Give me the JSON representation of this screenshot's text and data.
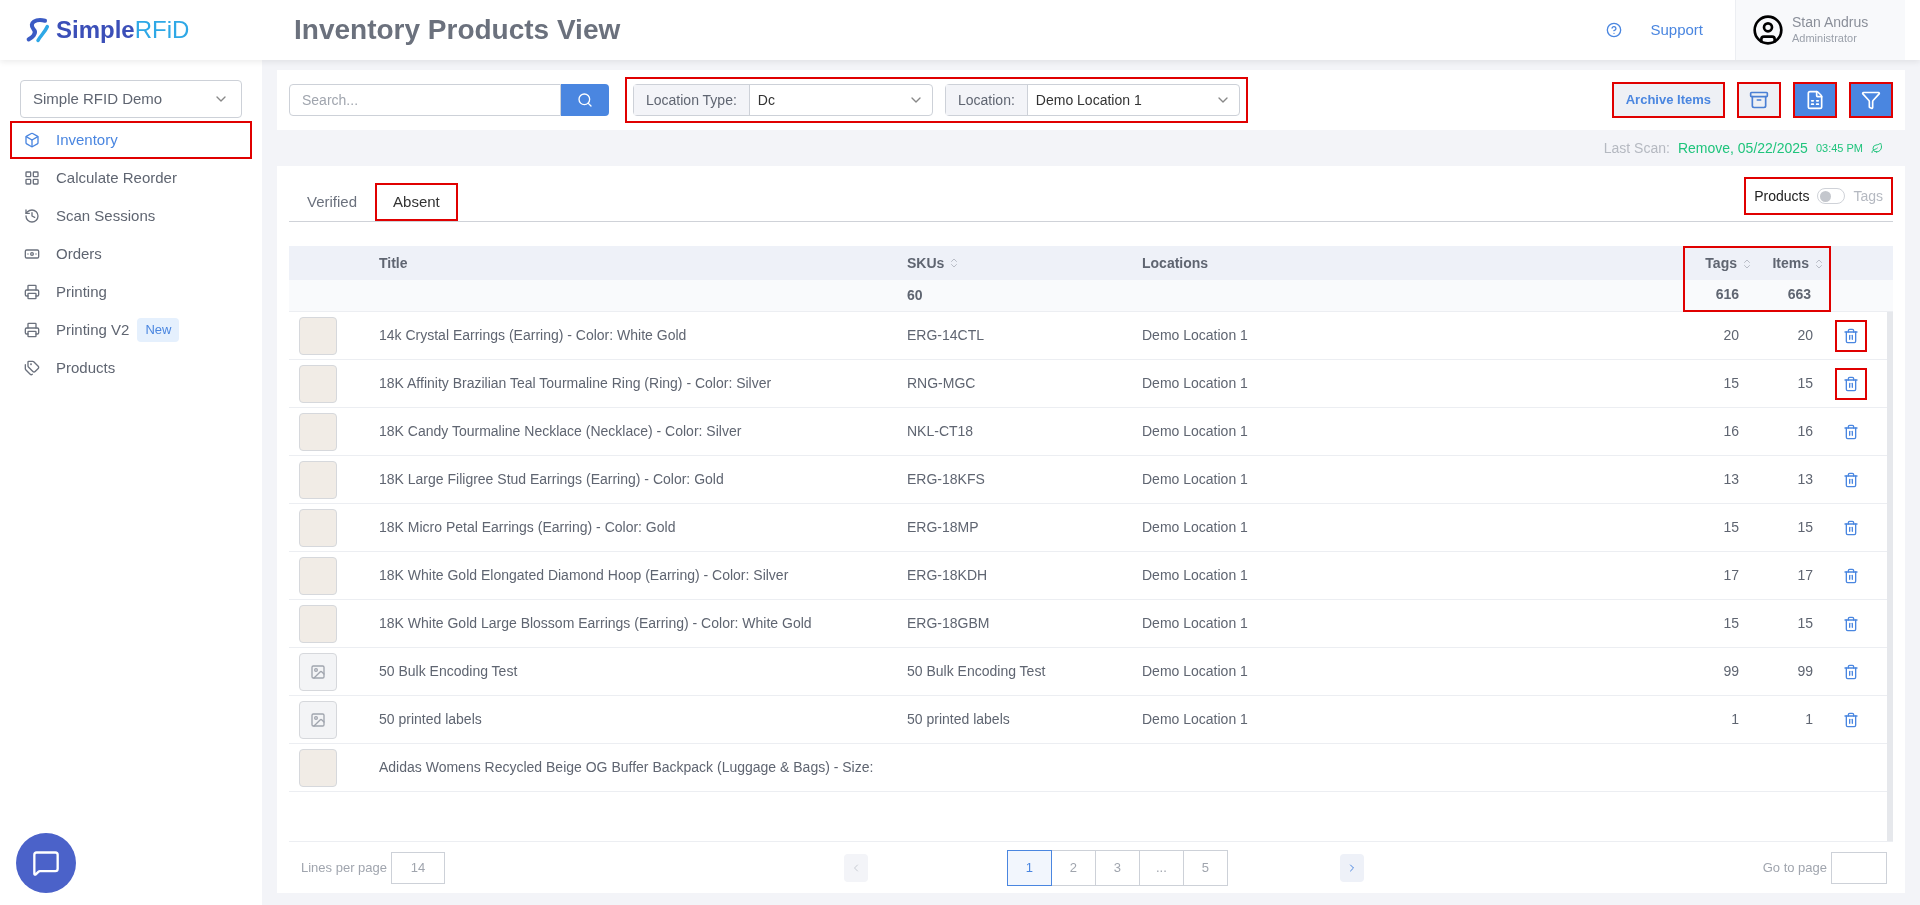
{
  "brand": {
    "name": "Simple",
    "name_accent": "RFiD"
  },
  "page_title": "Inventory Products View",
  "support": {
    "label": "Support"
  },
  "user": {
    "name": "Stan Andrus",
    "role": "Administrator"
  },
  "sidebar": {
    "account": "Simple RFID Demo",
    "items": [
      {
        "label": "Inventory",
        "selected": true,
        "highlighted": true
      },
      {
        "label": "Calculate Reorder",
        "selected": false,
        "highlighted": false
      },
      {
        "label": "Scan Sessions",
        "selected": false,
        "highlighted": false
      },
      {
        "label": "Orders",
        "selected": false,
        "highlighted": false
      },
      {
        "label": "Printing",
        "selected": false,
        "highlighted": false
      },
      {
        "label": "Printing V2",
        "badge": "New",
        "selected": false,
        "highlighted": false
      },
      {
        "label": "Products",
        "selected": false,
        "highlighted": false
      }
    ]
  },
  "toolbar": {
    "search": {
      "placeholder": "Search..."
    },
    "filters_highlighted": true,
    "filters": [
      {
        "label": "Location Type:",
        "value": "Dc"
      },
      {
        "label": "Location:",
        "value": "Demo Location 1"
      }
    ],
    "actions": [
      {
        "kind": "text",
        "label": "Archive Items",
        "highlighted": true
      },
      {
        "kind": "archive",
        "highlighted": true
      },
      {
        "kind": "excel",
        "highlighted": true
      },
      {
        "kind": "filter",
        "highlighted": true
      }
    ]
  },
  "last_scan": {
    "label": "Last Scan:",
    "value": "Remove, 05/22/2025",
    "time": "03:45 PM"
  },
  "tabs": [
    {
      "label": "Verified",
      "selected": false,
      "highlighted": false
    },
    {
      "label": "Absent",
      "selected": true,
      "highlighted": true
    }
  ],
  "view_toggle": {
    "left": "Products",
    "right": "Tags",
    "on": false,
    "highlighted": true
  },
  "table": {
    "columns": [
      {
        "label": "Title",
        "sortable": false
      },
      {
        "label": "SKUs",
        "sortable": true
      },
      {
        "label": "Locations",
        "sortable": false
      },
      {
        "label": "Tags",
        "sortable": true
      },
      {
        "label": "Items",
        "sortable": true
      }
    ],
    "totals": {
      "skus": "60",
      "tags": "616",
      "items": "663"
    },
    "totals_highlighted": true,
    "rows": [
      {
        "kind": "photo",
        "title": "14k Crystal Earrings (Earring) - Color: White Gold",
        "sku": "ERG-14CTL",
        "location": "Demo Location 1",
        "tags": "20",
        "items": "20",
        "highlighted": true
      },
      {
        "kind": "photo",
        "title": "18K Affinity Brazilian Teal Tourmaline Ring (Ring) - Color: Silver",
        "sku": "RNG-MGC",
        "location": "Demo Location 1",
        "tags": "15",
        "items": "15",
        "highlighted": true
      },
      {
        "kind": "photo",
        "title": "18K Candy Tourmaline Necklace (Necklace) - Color: Silver",
        "sku": "NKL-CT18",
        "location": "Demo Location 1",
        "tags": "16",
        "items": "16",
        "highlighted": false
      },
      {
        "kind": "photo",
        "title": "18K Large Filigree Stud Earrings (Earring) - Color: Gold",
        "sku": "ERG-18KFS",
        "location": "Demo Location 1",
        "tags": "13",
        "items": "13",
        "highlighted": false
      },
      {
        "kind": "photo",
        "title": "18K Micro Petal Earrings (Earring) - Color: Gold",
        "sku": "ERG-18MP",
        "location": "Demo Location 1",
        "tags": "15",
        "items": "15",
        "highlighted": false
      },
      {
        "kind": "photo",
        "title": "18K White Gold Elongated Diamond Hoop (Earring) - Color: Silver",
        "sku": "ERG-18KDH",
        "location": "Demo Location 1",
        "tags": "17",
        "items": "17",
        "highlighted": false
      },
      {
        "kind": "photo",
        "title": "18K White Gold Large Blossom Earrings (Earring) - Color: White Gold",
        "sku": "ERG-18GBM",
        "location": "Demo Location 1",
        "tags": "15",
        "items": "15",
        "highlighted": false
      },
      {
        "kind": "placeholder",
        "title": "50 Bulk Encoding Test",
        "sku": "50 Bulk Encoding Test",
        "location": "Demo Location 1",
        "tags": "99",
        "items": "99",
        "highlighted": false
      },
      {
        "kind": "placeholder",
        "title": "50 printed labels",
        "sku": "50 printed labels",
        "location": "Demo Location 1",
        "tags": "1",
        "items": "1",
        "highlighted": false
      },
      {
        "kind": "photo",
        "title": "Adidas Womens Recycled Beige OG Buffer Backpack (Luggage & Bags) - Size:"
      }
    ]
  },
  "pagination": {
    "lines_label": "Lines per page",
    "lines_value": "14",
    "pages": [
      {
        "label": "1",
        "selected": true
      },
      {
        "label": "2",
        "selected": false
      },
      {
        "label": "3",
        "selected": false
      },
      {
        "label": "...",
        "selected": false
      },
      {
        "label": "5",
        "selected": false
      }
    ],
    "prev_disabled": true,
    "next_disabled": false,
    "goto_label": "Go to page"
  }
}
